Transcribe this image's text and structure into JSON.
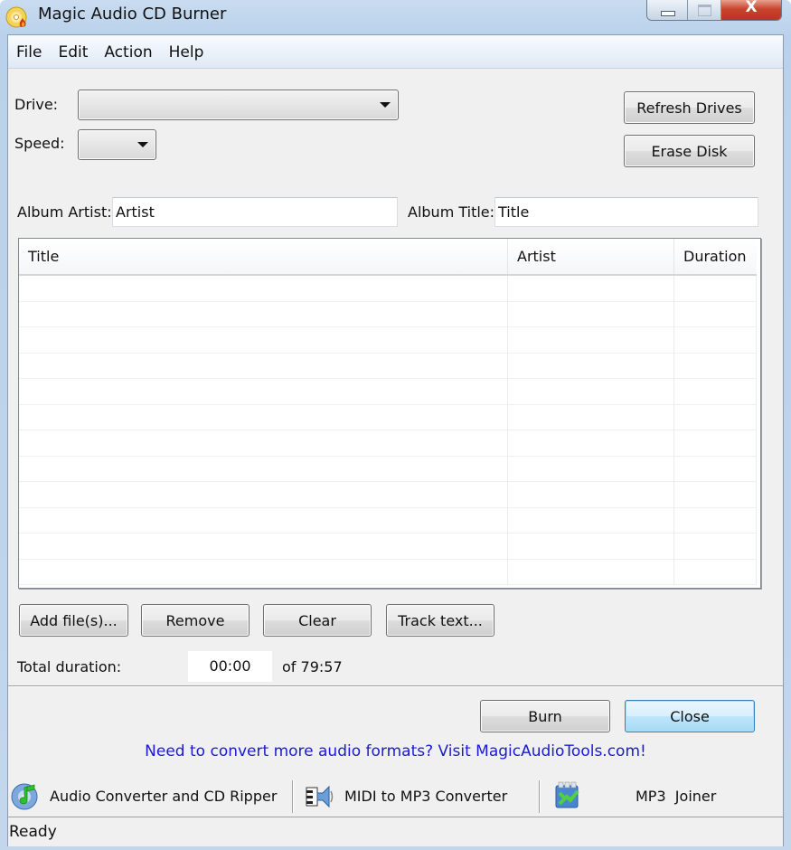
{
  "window": {
    "title": "Magic Audio CD Burner",
    "icon": "cd-burner-app-icon",
    "controls": {
      "minimize": "minimize-icon",
      "maximize": "maximize-icon",
      "close": "close-icon",
      "close_glyph": "X"
    }
  },
  "menubar": {
    "items": [
      {
        "label": "File"
      },
      {
        "label": "Edit"
      },
      {
        "label": "Action"
      },
      {
        "label": "Help"
      }
    ]
  },
  "drive": {
    "label": "Drive:",
    "selected": ""
  },
  "speed": {
    "label": "Speed:",
    "selected": ""
  },
  "buttons": {
    "refresh_drives": "Refresh Drives",
    "erase_disk": "Erase Disk",
    "add_files": "Add file(s)...",
    "remove": "Remove",
    "clear": "Clear",
    "track_text": "Track text...",
    "burn": "Burn",
    "close": "Close"
  },
  "album": {
    "artist_label": "Album Artist:",
    "artist_value": "Artist",
    "title_label": "Album Title:",
    "title_value": "Title"
  },
  "tracklist": {
    "columns": [
      {
        "label": "Title"
      },
      {
        "label": "Artist"
      },
      {
        "label": "Duration"
      }
    ],
    "rows": []
  },
  "duration": {
    "label": "Total duration:",
    "value": "00:00",
    "capacity": "of 79:57"
  },
  "promo_link": "Need to convert more audio formats? Visit MagicAudioTools.com!",
  "tools": [
    {
      "label": "Audio Converter and CD Ripper",
      "icon": "audio-converter-icon"
    },
    {
      "label": "MIDI to MP3 Converter",
      "icon": "midi-converter-icon"
    },
    {
      "label": "MP3  Joiner",
      "icon": "mp3-joiner-icon"
    }
  ],
  "status": "Ready",
  "colors": {
    "link": "#1a1ad4",
    "default_button_border": "#3c7fb1",
    "close_button": "#c9452f"
  }
}
